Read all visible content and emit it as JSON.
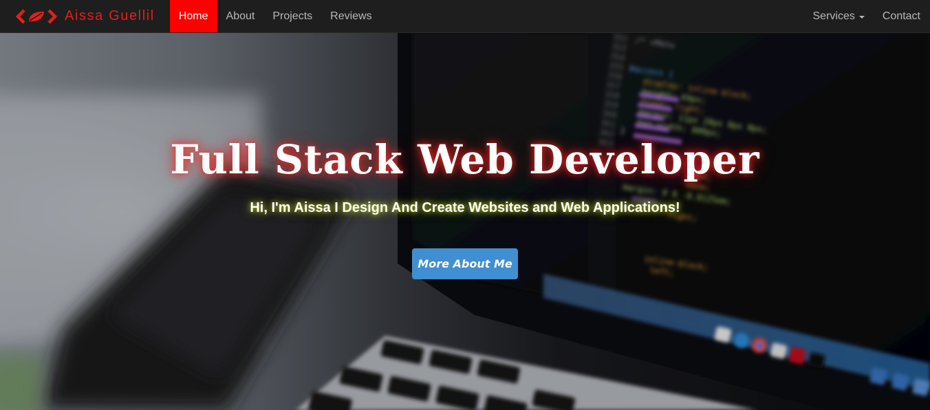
{
  "brand": {
    "name": "Aissa Guellil",
    "logo_icon": "code-brackets-leaf-icon",
    "accent_color": "#e0201c"
  },
  "nav": {
    "left_items": [
      {
        "label": "Home",
        "active": true
      },
      {
        "label": "About",
        "active": false
      },
      {
        "label": "Projects",
        "active": false
      },
      {
        "label": "Reviews",
        "active": false
      }
    ],
    "right_items": [
      {
        "label": "Services",
        "dropdown": true
      },
      {
        "label": "Contact",
        "dropdown": false
      }
    ],
    "active_color": "#ff0000"
  },
  "hero": {
    "title": "Full Stack Web Developer",
    "subtitle": "Hi, I'm Aissa I Design And Create Websites and Web Applications!",
    "cta_label": "More About Me",
    "cta_color": "#3f8fd2",
    "code_lines": [
      "/* =Menu",
      "#access {",
      "display: inline-block;",
      "height: 69px;",
      "float: right;",
      "margin: 11px 28px 0px 0px;",
      "max-width: 800px;",
      "}",
      "13px;",
      "none;",
      "margin: 0 0 -0.8125em;",
      "99999;",
      "right;",
      "inline-block;",
      "left;"
    ],
    "line_numbers": [
      "352",
      "353",
      "354",
      "355",
      "356",
      "357",
      "358",
      "359",
      "360",
      "361",
      "362",
      "363"
    ]
  }
}
